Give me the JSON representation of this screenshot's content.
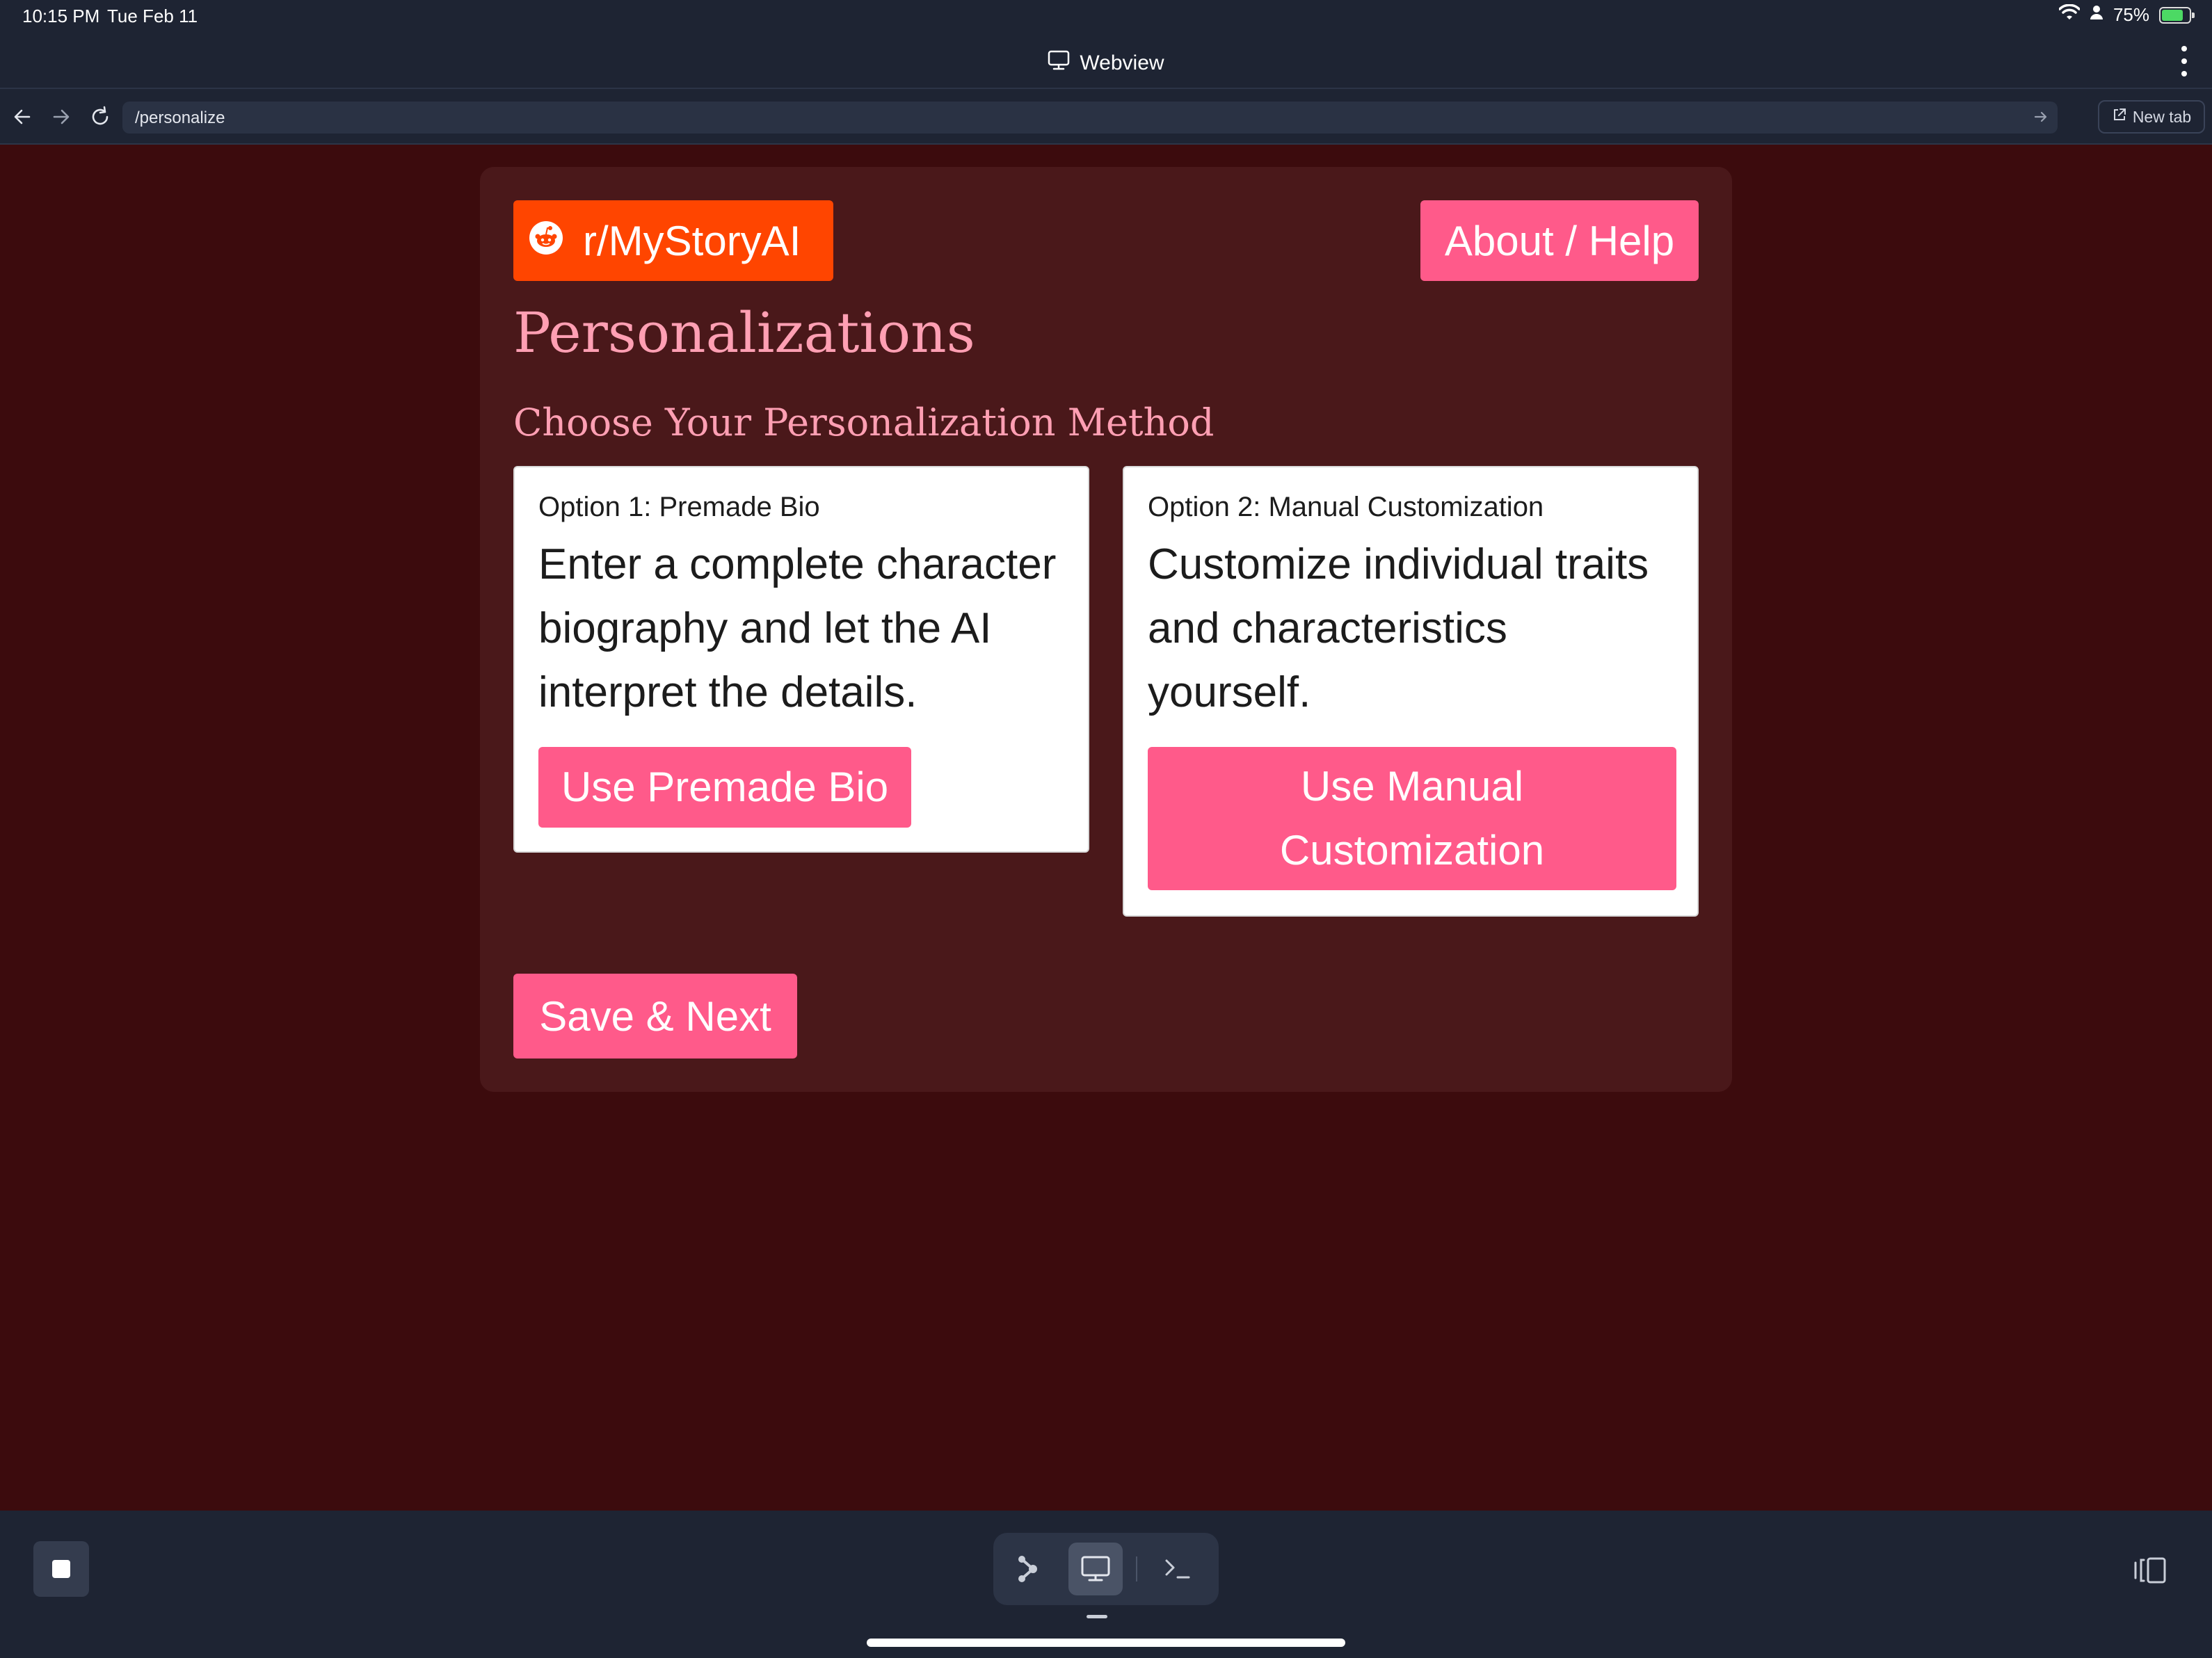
{
  "status_bar": {
    "time": "10:15 PM",
    "date": "Tue Feb 11",
    "battery": "75%"
  },
  "window": {
    "title": "Webview",
    "icon": "monitor-icon"
  },
  "browser": {
    "url": "/personalize",
    "new_tab_label": "New tab"
  },
  "header": {
    "subreddit_label": "r/MyStoryAI",
    "about_label": "About / Help"
  },
  "page": {
    "title": "Personalizations",
    "section_title": "Choose Your Personalization Method"
  },
  "options": [
    {
      "title": "Option 1: Premade Bio",
      "description": "Enter a complete character biography and let the AI interpret the details.",
      "button_label": "Use Premade Bio"
    },
    {
      "title": "Option 2: Manual Customization",
      "description": "Customize individual traits and characteristics yourself.",
      "button_label": "Use Manual Customization"
    }
  ],
  "footer": {
    "save_label": "Save & Next"
  },
  "colors": {
    "accent": "#ff5a8a",
    "reddit": "#ff4500",
    "background": "#3c0b0d",
    "panel": "#4a181a",
    "heading": "#ff9fb3",
    "chrome": "#1e2433"
  }
}
